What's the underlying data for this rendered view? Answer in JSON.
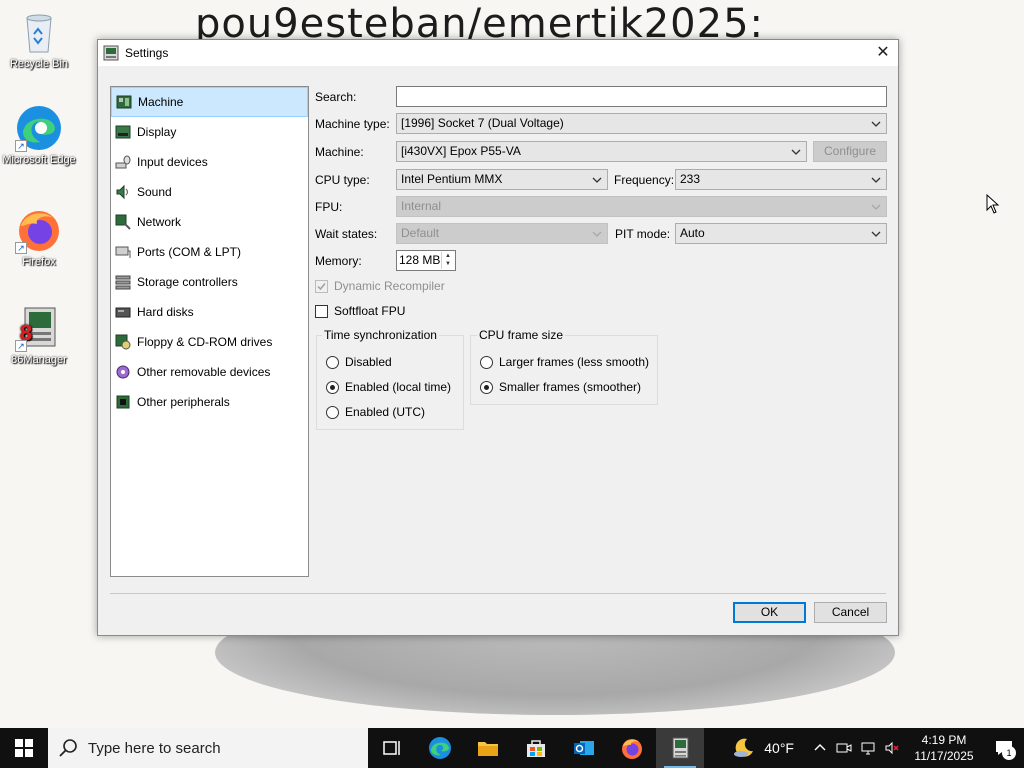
{
  "wallpaper": {
    "text": "pou9esteban/emertik2025:"
  },
  "desktop_icons": [
    {
      "label": "Recycle Bin",
      "icon": "recycle-bin-icon"
    },
    {
      "label": "Microsoft Edge",
      "icon": "edge-icon"
    },
    {
      "label": "Firefox",
      "icon": "firefox-icon"
    },
    {
      "label": "86Manager",
      "icon": "86box-manager-icon"
    }
  ],
  "dialog": {
    "title": "Settings",
    "nav": [
      {
        "label": "Machine",
        "icon": "machine-icon"
      },
      {
        "label": "Display",
        "icon": "display-icon"
      },
      {
        "label": "Input devices",
        "icon": "input-devices-icon"
      },
      {
        "label": "Sound",
        "icon": "sound-icon"
      },
      {
        "label": "Network",
        "icon": "network-icon"
      },
      {
        "label": "Ports (COM & LPT)",
        "icon": "ports-icon"
      },
      {
        "label": "Storage controllers",
        "icon": "storage-controllers-icon"
      },
      {
        "label": "Hard disks",
        "icon": "hard-disks-icon"
      },
      {
        "label": "Floppy & CD-ROM drives",
        "icon": "floppy-cdrom-icon"
      },
      {
        "label": "Other removable devices",
        "icon": "removable-devices-icon"
      },
      {
        "label": "Other peripherals",
        "icon": "peripherals-icon"
      }
    ],
    "selected_nav": "Machine",
    "form": {
      "search_label": "Search:",
      "search_value": "",
      "machine_type_label": "Machine type:",
      "machine_type_value": "[1996] Socket 7 (Dual Voltage)",
      "machine_label": "Machine:",
      "machine_value": "[i430VX] Epox P55-VA",
      "configure_label": "Configure",
      "cpu_type_label": "CPU type:",
      "cpu_type_value": "Intel Pentium MMX",
      "frequency_label": "Frequency:",
      "frequency_value": "233",
      "fpu_label": "FPU:",
      "fpu_value": "Internal",
      "wait_states_label": "Wait states:",
      "wait_states_value": "Default",
      "pit_mode_label": "PIT mode:",
      "pit_mode_value": "Auto",
      "memory_label": "Memory:",
      "memory_value": "128 MB",
      "dynamic_recompiler_label": "Dynamic Recompiler",
      "dynamic_recompiler_checked": true,
      "softfloat_fpu_label": "Softfloat FPU",
      "softfloat_fpu_checked": false
    },
    "time_sync": {
      "title": "Time synchronization",
      "options": [
        "Disabled",
        "Enabled (local time)",
        "Enabled (UTC)"
      ],
      "selected": "Enabled (local time)"
    },
    "cpu_frame": {
      "title": "CPU frame size",
      "options": [
        "Larger frames (less smooth)",
        "Smaller frames (smoother)"
      ],
      "selected": "Smaller frames (smoother)"
    },
    "ok_label": "OK",
    "cancel_label": "Cancel"
  },
  "taskbar": {
    "search_placeholder": "Type here to search",
    "apps": [
      "task-view-icon",
      "edge-icon",
      "file-explorer-icon",
      "store-icon",
      "outlook-icon",
      "firefox-icon",
      "86box-icon"
    ],
    "weather": "40°F",
    "time": "4:19 PM",
    "date": "11/17/2025",
    "notification_count": "1"
  },
  "colors": {
    "selection": "#cce8ff",
    "accent": "#0078d7",
    "taskbar": "#101010"
  }
}
